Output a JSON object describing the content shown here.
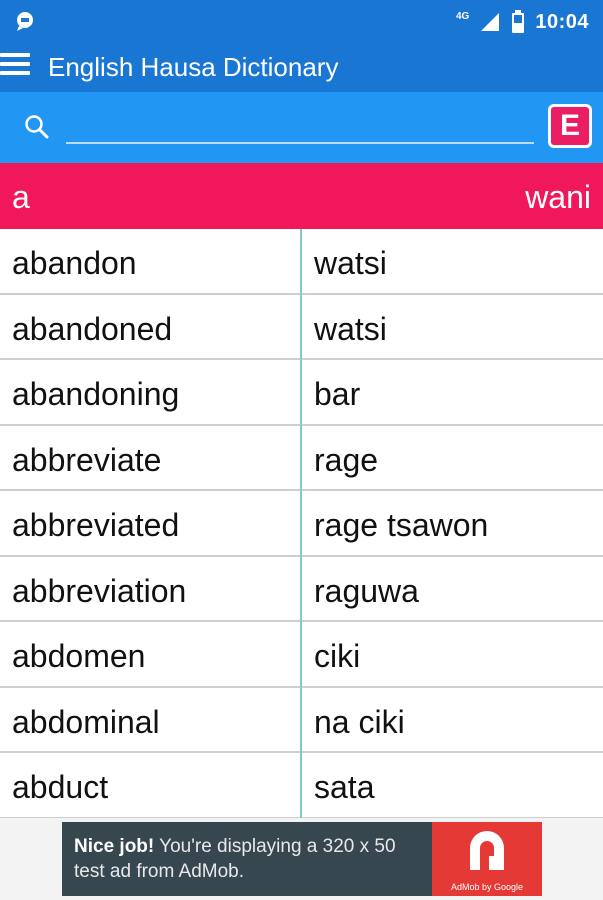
{
  "status_bar": {
    "network": "4G",
    "time": "10:04"
  },
  "app_bar": {
    "title": "English Hausa Dictionary"
  },
  "search": {
    "value": "",
    "placeholder": "",
    "language_button": "E"
  },
  "list_header": {
    "left": "a",
    "right": "wani"
  },
  "entries": [
    {
      "english": "abandon",
      "hausa": "watsi"
    },
    {
      "english": "abandoned",
      "hausa": "watsi"
    },
    {
      "english": "abandoning",
      "hausa": "bar"
    },
    {
      "english": "abbreviate",
      "hausa": "rage"
    },
    {
      "english": "abbreviated",
      "hausa": "rage tsawon"
    },
    {
      "english": "abbreviation",
      "hausa": "raguwa"
    },
    {
      "english": "abdomen",
      "hausa": "ciki"
    },
    {
      "english": "abdominal",
      "hausa": "na ciki"
    },
    {
      "english": "abduct",
      "hausa": "sata"
    }
  ],
  "ad": {
    "headline": "Nice job!",
    "body": "You're displaying a 320 x 50 test ad from AdMob.",
    "logo_caption": "AdMob by Google"
  },
  "colors": {
    "app_bar": "#1976d2",
    "search_bar": "#2196f3",
    "accent": "#f0185b",
    "divider": "#80cbc4"
  }
}
